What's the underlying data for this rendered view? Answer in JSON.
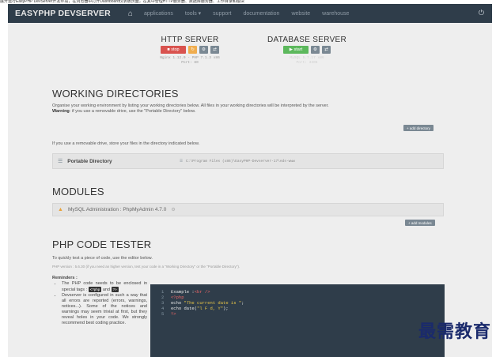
{
  "caption": "展开运行EasyPHP DevServer开发环境，在浏览器中打开Dashboard仪表板页面，在其中管理HTTP服务器、数据库服务器、工作目录和模块",
  "navbar": {
    "brand": "EASYPHP DEVSERVER",
    "home_icon": "home-icon",
    "links": [
      "applications",
      "tools ▾",
      "support",
      "documentation",
      "website",
      "warehouse"
    ],
    "right_icon": "power-icon"
  },
  "http_server": {
    "title": "HTTP SERVER",
    "stop_label": "■ stop",
    "info_line1": "Nginx 1.12.0 - PHP 7.1.3 x86",
    "info_line2": "Port: 80"
  },
  "database_server": {
    "title": "DATABASE SERVER",
    "start_label": "▶ start",
    "info_line1": "MySQL 5.7.17 x86",
    "info_line2": "Port: 3306"
  },
  "working_dirs": {
    "heading": "WORKING DIRECTORIES",
    "desc": "Organise your working environment by listing your working directories below. All files in your working directories will be interpreted by the server.",
    "warning_label": "Warning",
    "warning_text": ": if you use a removable drive, use the \"Portable Directory\" below.",
    "add_button": "+ add directory",
    "removable_text": "If you use a removable drive, store your files in the directory indicated below.",
    "portable_label": "Portable Directory",
    "portable_path": "C:\\Program Files (x86)\\EasyPHP-Devserver-17\\eds-www"
  },
  "modules": {
    "heading": "MODULES",
    "item_label": "MySQL Administration : PhpMyAdmin 4.7.0",
    "add_button": "+ add modules"
  },
  "php_tester": {
    "heading": "PHP CODE TESTER",
    "desc": "To quickly test a piece of code, use the editor below.",
    "version_text": "PHP version : 5.6.30 (if you need an higher version, test your code in a \"Working Directory\" or the \"Portable Directory\").",
    "reminders_title": "Reminders :",
    "reminder1_a": "The PHP code needs to be enclosed in special tags :",
    "tag_open": "<?php",
    "tag_and": "and",
    "tag_close": "?>",
    "reminder2": "Devserver is configured in such a way that all errors are reported (errors, warnings, notices...). Some of the notices and warnings may seem trivial at first, but they reveal holes in your code. We strongly recommend best coding practice.",
    "code": [
      {
        "n": "1",
        "a": "Example :",
        "b": "<br />",
        "c": ""
      },
      {
        "n": "2",
        "a": "",
        "b": "<?php",
        "c": ""
      },
      {
        "n": "3",
        "a": "echo ",
        "b": "\"The current date is \"",
        "c": ";"
      },
      {
        "n": "4",
        "a": "echo date(",
        "b": "\"l F d, Y\"",
        "c": ");"
      },
      {
        "n": "5",
        "a": "",
        "b": "?>",
        "c": ""
      }
    ]
  },
  "watermark": "最需教育",
  "colors": {
    "navbar": "#2f3d4a",
    "stop": "#d9534f",
    "start": "#5cb85c",
    "restart": "#f0ad4e"
  }
}
